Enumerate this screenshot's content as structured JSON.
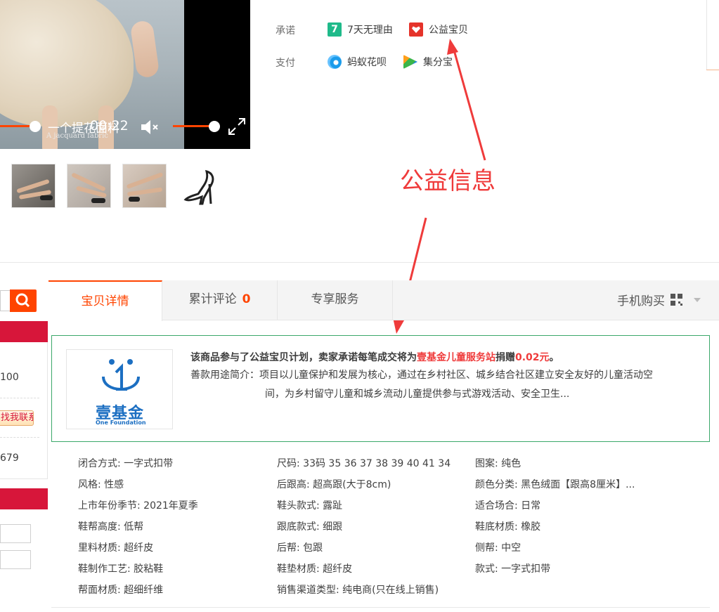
{
  "video": {
    "caption": "一个提花面料",
    "subcaption": "A jacquard fabric",
    "time": "00:22"
  },
  "thumbnails": [
    {
      "name": "shoe-on-foot-1"
    },
    {
      "name": "shoe-on-foot-2"
    },
    {
      "name": "shoe-on-foot-3"
    },
    {
      "name": "shoe-product"
    }
  ],
  "promise": {
    "label": "承诺",
    "items": [
      {
        "icon": "seven-days-icon",
        "text": "7天无理由"
      },
      {
        "icon": "charity-heart-icon",
        "text": "公益宝贝"
      }
    ]
  },
  "payment": {
    "label": "支付",
    "items": [
      {
        "icon": "ant-huabei-icon",
        "text": "蚂蚁花呗"
      },
      {
        "icon": "jifenbao-icon",
        "text": "集分宝"
      }
    ]
  },
  "annotation": {
    "label": "公益信息",
    "color": "#ef3b3b"
  },
  "sidebar": {
    "value1": "100",
    "contact": "找我联系",
    "value2": "679"
  },
  "tabs": [
    {
      "label": "宝贝详情",
      "active": true
    },
    {
      "label": "累计评论",
      "count": "0"
    },
    {
      "label": "专享服务"
    }
  ],
  "mobile_buy": "手机购买",
  "charity": {
    "logo_zh": "壹基金",
    "logo_en": "One Foundation",
    "line1_prefix": "该商品参与了公益宝贝计划，卖家承诺每笔成交将为",
    "line1_org": "壹基金儿童服务站",
    "line1_mid": "捐赠",
    "line1_amount": "0.02元",
    "line1_suffix": "。",
    "line2": "善款用途简介：项目以儿童保护和发展为核心，通过在乡村社区、城乡结合社区建立安全友好的儿童活动空",
    "line3": "间，为乡村留守儿童和城乡流动儿童提供参与式游戏活动、安全卫生..."
  },
  "attributes": [
    [
      "闭合方式: 一字式扣带",
      "尺码: 33码 35 36 37 38 39 40 41 34",
      "图案: 纯色"
    ],
    [
      "风格: 性感",
      "后跟高: 超高跟(大于8cm)",
      "颜色分类: 黑色绒面【跟高8厘米】..."
    ],
    [
      "上市年份季节: 2021年夏季",
      "鞋头款式: 露趾",
      "适合场合: 日常"
    ],
    [
      "鞋帮高度: 低帮",
      "跟底款式: 细跟",
      "鞋底材质: 橡胶"
    ],
    [
      "里料材质: 超纤皮",
      "后帮: 包跟",
      "侧帮: 中空"
    ],
    [
      "鞋制作工艺: 胶粘鞋",
      "鞋垫材质: 超纤皮",
      "款式: 一字式扣带"
    ],
    [
      "帮面材质: 超细纤维",
      "销售渠道类型: 纯电商(只在线上销售)",
      ""
    ]
  ],
  "colors": {
    "accent": "#ff4400",
    "sidebar_red": "#d7163a",
    "charity_border": "#3ba86a",
    "link_blue": "#1c6fc2"
  }
}
